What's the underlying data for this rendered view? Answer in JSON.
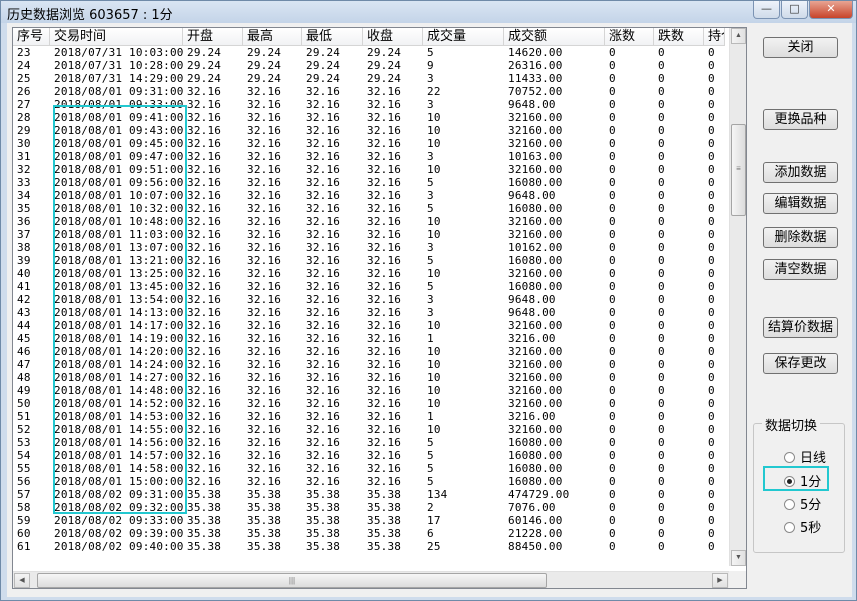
{
  "window": {
    "title": "历史数据浏览 603657 : 1分",
    "minimize_glyph": "—",
    "maximize_glyph": "□",
    "close_glyph": "✕"
  },
  "table": {
    "columns": [
      "序号",
      "交易时间",
      "开盘",
      "最高",
      "最低",
      "收盘",
      "成交量",
      "成交额",
      "涨数",
      "跌数",
      "持仓"
    ],
    "rows": [
      [
        "23",
        "2018/07/31 10:03:00",
        "29.24",
        "29.24",
        "29.24",
        "29.24",
        "5",
        "14620.00",
        "0",
        "0",
        "0"
      ],
      [
        "24",
        "2018/07/31 10:28:00",
        "29.24",
        "29.24",
        "29.24",
        "29.24",
        "9",
        "26316.00",
        "0",
        "0",
        "0"
      ],
      [
        "25",
        "2018/07/31 14:29:00",
        "29.24",
        "29.24",
        "29.24",
        "29.24",
        "3",
        "11433.00",
        "0",
        "0",
        "0"
      ],
      [
        "26",
        "2018/08/01 09:31:00",
        "32.16",
        "32.16",
        "32.16",
        "32.16",
        "22",
        "70752.00",
        "0",
        "0",
        "0"
      ],
      [
        "27",
        "2018/08/01 09:33:00",
        "32.16",
        "32.16",
        "32.16",
        "32.16",
        "3",
        "9648.00",
        "0",
        "0",
        "0"
      ],
      [
        "28",
        "2018/08/01 09:41:00",
        "32.16",
        "32.16",
        "32.16",
        "32.16",
        "10",
        "32160.00",
        "0",
        "0",
        "0"
      ],
      [
        "29",
        "2018/08/01 09:43:00",
        "32.16",
        "32.16",
        "32.16",
        "32.16",
        "10",
        "32160.00",
        "0",
        "0",
        "0"
      ],
      [
        "30",
        "2018/08/01 09:45:00",
        "32.16",
        "32.16",
        "32.16",
        "32.16",
        "10",
        "32160.00",
        "0",
        "0",
        "0"
      ],
      [
        "31",
        "2018/08/01 09:47:00",
        "32.16",
        "32.16",
        "32.16",
        "32.16",
        "3",
        "10163.00",
        "0",
        "0",
        "0"
      ],
      [
        "32",
        "2018/08/01 09:51:00",
        "32.16",
        "32.16",
        "32.16",
        "32.16",
        "10",
        "32160.00",
        "0",
        "0",
        "0"
      ],
      [
        "33",
        "2018/08/01 09:56:00",
        "32.16",
        "32.16",
        "32.16",
        "32.16",
        "5",
        "16080.00",
        "0",
        "0",
        "0"
      ],
      [
        "34",
        "2018/08/01 10:07:00",
        "32.16",
        "32.16",
        "32.16",
        "32.16",
        "3",
        "9648.00",
        "0",
        "0",
        "0"
      ],
      [
        "35",
        "2018/08/01 10:32:00",
        "32.16",
        "32.16",
        "32.16",
        "32.16",
        "5",
        "16080.00",
        "0",
        "0",
        "0"
      ],
      [
        "36",
        "2018/08/01 10:48:00",
        "32.16",
        "32.16",
        "32.16",
        "32.16",
        "10",
        "32160.00",
        "0",
        "0",
        "0"
      ],
      [
        "37",
        "2018/08/01 11:03:00",
        "32.16",
        "32.16",
        "32.16",
        "32.16",
        "10",
        "32160.00",
        "0",
        "0",
        "0"
      ],
      [
        "38",
        "2018/08/01 13:07:00",
        "32.16",
        "32.16",
        "32.16",
        "32.16",
        "3",
        "10162.00",
        "0",
        "0",
        "0"
      ],
      [
        "39",
        "2018/08/01 13:21:00",
        "32.16",
        "32.16",
        "32.16",
        "32.16",
        "5",
        "16080.00",
        "0",
        "0",
        "0"
      ],
      [
        "40",
        "2018/08/01 13:25:00",
        "32.16",
        "32.16",
        "32.16",
        "32.16",
        "10",
        "32160.00",
        "0",
        "0",
        "0"
      ],
      [
        "41",
        "2018/08/01 13:45:00",
        "32.16",
        "32.16",
        "32.16",
        "32.16",
        "5",
        "16080.00",
        "0",
        "0",
        "0"
      ],
      [
        "42",
        "2018/08/01 13:54:00",
        "32.16",
        "32.16",
        "32.16",
        "32.16",
        "3",
        "9648.00",
        "0",
        "0",
        "0"
      ],
      [
        "43",
        "2018/08/01 14:13:00",
        "32.16",
        "32.16",
        "32.16",
        "32.16",
        "3",
        "9648.00",
        "0",
        "0",
        "0"
      ],
      [
        "44",
        "2018/08/01 14:17:00",
        "32.16",
        "32.16",
        "32.16",
        "32.16",
        "10",
        "32160.00",
        "0",
        "0",
        "0"
      ],
      [
        "45",
        "2018/08/01 14:19:00",
        "32.16",
        "32.16",
        "32.16",
        "32.16",
        "1",
        "3216.00",
        "0",
        "0",
        "0"
      ],
      [
        "46",
        "2018/08/01 14:20:00",
        "32.16",
        "32.16",
        "32.16",
        "32.16",
        "10",
        "32160.00",
        "0",
        "0",
        "0"
      ],
      [
        "47",
        "2018/08/01 14:24:00",
        "32.16",
        "32.16",
        "32.16",
        "32.16",
        "10",
        "32160.00",
        "0",
        "0",
        "0"
      ],
      [
        "48",
        "2018/08/01 14:27:00",
        "32.16",
        "32.16",
        "32.16",
        "32.16",
        "10",
        "32160.00",
        "0",
        "0",
        "0"
      ],
      [
        "49",
        "2018/08/01 14:48:00",
        "32.16",
        "32.16",
        "32.16",
        "32.16",
        "10",
        "32160.00",
        "0",
        "0",
        "0"
      ],
      [
        "50",
        "2018/08/01 14:52:00",
        "32.16",
        "32.16",
        "32.16",
        "32.16",
        "10",
        "32160.00",
        "0",
        "0",
        "0"
      ],
      [
        "51",
        "2018/08/01 14:53:00",
        "32.16",
        "32.16",
        "32.16",
        "32.16",
        "1",
        "3216.00",
        "0",
        "0",
        "0"
      ],
      [
        "52",
        "2018/08/01 14:55:00",
        "32.16",
        "32.16",
        "32.16",
        "32.16",
        "10",
        "32160.00",
        "0",
        "0",
        "0"
      ],
      [
        "53",
        "2018/08/01 14:56:00",
        "32.16",
        "32.16",
        "32.16",
        "32.16",
        "5",
        "16080.00",
        "0",
        "0",
        "0"
      ],
      [
        "54",
        "2018/08/01 14:57:00",
        "32.16",
        "32.16",
        "32.16",
        "32.16",
        "5",
        "16080.00",
        "0",
        "0",
        "0"
      ],
      [
        "55",
        "2018/08/01 14:58:00",
        "32.16",
        "32.16",
        "32.16",
        "32.16",
        "5",
        "16080.00",
        "0",
        "0",
        "0"
      ],
      [
        "56",
        "2018/08/01 15:00:00",
        "32.16",
        "32.16",
        "32.16",
        "32.16",
        "5",
        "16080.00",
        "0",
        "0",
        "0"
      ],
      [
        "57",
        "2018/08/02 09:31:00",
        "35.38",
        "35.38",
        "35.38",
        "35.38",
        "134",
        "474729.00",
        "0",
        "0",
        "0"
      ],
      [
        "58",
        "2018/08/02 09:32:00",
        "35.38",
        "35.38",
        "35.38",
        "35.38",
        "2",
        "7076.00",
        "0",
        "0",
        "0"
      ],
      [
        "59",
        "2018/08/02 09:33:00",
        "35.38",
        "35.38",
        "35.38",
        "35.38",
        "17",
        "60146.00",
        "0",
        "0",
        "0"
      ],
      [
        "60",
        "2018/08/02 09:39:00",
        "35.38",
        "35.38",
        "35.38",
        "35.38",
        "6",
        "21228.00",
        "0",
        "0",
        "0"
      ],
      [
        "61",
        "2018/08/02 09:40:00",
        "35.38",
        "35.38",
        "35.38",
        "35.38",
        "25",
        "88450.00",
        "0",
        "0",
        "0"
      ]
    ]
  },
  "buttons": {
    "close": "关闭",
    "change_symbol": "更换品种",
    "add_data": "添加数据",
    "edit_data": "编辑数据",
    "delete_data": "删除数据",
    "clear_data": "清空数据",
    "settlement_data": "结算价数据",
    "save_changes": "保存更改"
  },
  "data_switch": {
    "title": "数据切换",
    "options": [
      "日线",
      "1分",
      "5分",
      "5秒"
    ],
    "selected": "1分"
  },
  "scroll": {
    "up": "▲",
    "down": "▼",
    "left": "◀",
    "right": "▶",
    "v_grip": "≡",
    "h_grip": "|||"
  },
  "highlight_color": "#22c8d0"
}
